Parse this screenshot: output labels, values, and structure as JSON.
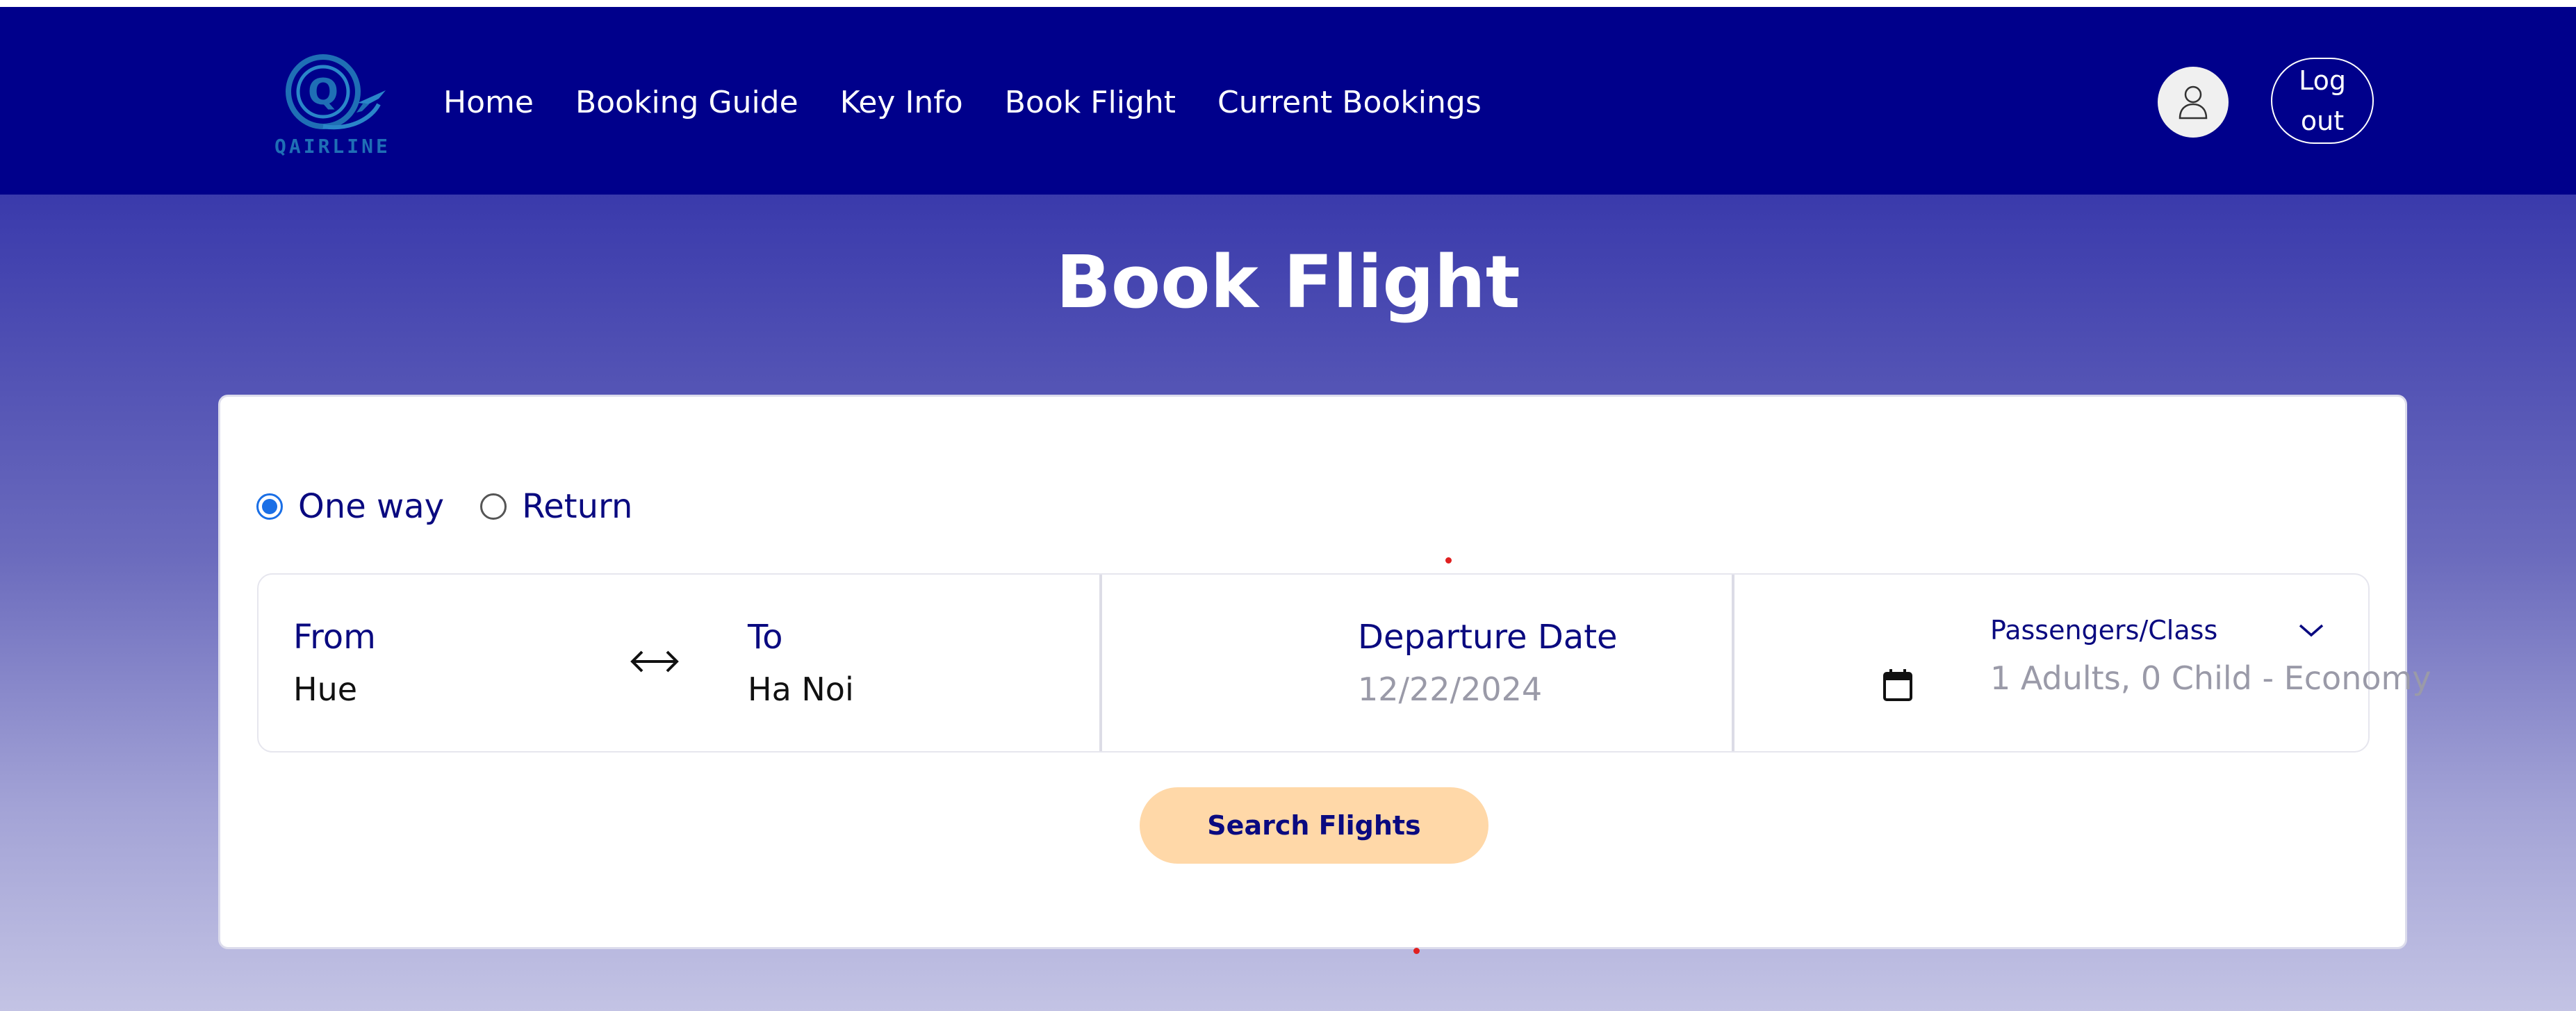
{
  "header": {
    "logo_text": "QAIRLINE",
    "nav": [
      "Home",
      "Booking Guide",
      "Key Info",
      "Book Flight",
      "Current Bookings"
    ],
    "logout_line1": "Log",
    "logout_line2": "out"
  },
  "page": {
    "title": "Book Flight"
  },
  "form": {
    "trip_types": [
      {
        "label": "One way",
        "checked": true
      },
      {
        "label": "Return",
        "checked": false
      }
    ],
    "from_label": "From",
    "from_value": "Hue",
    "to_label": "To",
    "to_value": "Ha Noi",
    "departure_label": "Departure Date",
    "departure_value": "12/22/2024",
    "passengers_label": "Passengers/Class",
    "passengers_value": "1 Adults, 0 Child - Economy",
    "search_label": "Search Flights"
  },
  "colors": {
    "header_bg": "#00008b",
    "accent_text": "#0a0a80",
    "button_bg": "#ffd8a8",
    "radio_checked": "#1a6fe6"
  },
  "icons": {
    "logo": "airline-logo-icon",
    "avatar": "user-icon",
    "swap": "swap-arrows-icon",
    "calendar": "calendar-icon",
    "dropdown": "chevron-down-icon"
  }
}
